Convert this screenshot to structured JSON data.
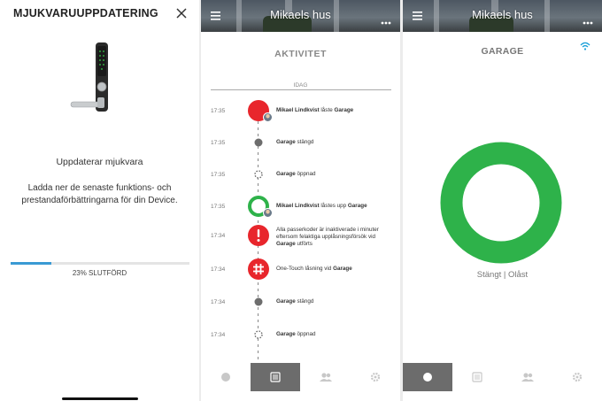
{
  "firmware": {
    "title": "MJUKVARUUPPDATERING",
    "updating_label": "Uppdaterar mjukvara",
    "description": "Ladda ner de senaste funktions- och prestandaförbättringarna för din Device.",
    "progress": 0.23,
    "progress_text": "23% SLUTFÖRD"
  },
  "activity": {
    "home_title": "Mikaels hus",
    "title": "AKTIVITET",
    "day_label": "IDAG",
    "events": [
      {
        "time": "17:35",
        "type": "user-locked",
        "color": "#e8262c",
        "actor": "Mikael Lindkvist",
        "action": " låste ",
        "target": "Garage"
      },
      {
        "time": "17:35",
        "type": "closed",
        "color": "#6d6d6d",
        "actor": "",
        "action": "",
        "target": "Garage",
        "suffix": " stängd"
      },
      {
        "time": "17:35",
        "type": "opened",
        "color": "#6d6d6d",
        "actor": "",
        "action": "",
        "target": "Garage",
        "suffix": " öppnad"
      },
      {
        "time": "17:35",
        "type": "user-unlocked",
        "color": "#2eb24a",
        "actor": "Mikael Lindkvist",
        "action": " låstes upp ",
        "target": "Garage"
      },
      {
        "time": "17:34",
        "type": "alert",
        "color": "#e8262c",
        "text": "Alla passerkoder är inaktiverade i minuter eftersom felaktiga upplåsningsförsök vid ",
        "target": "Garage",
        "suffix": " utförts"
      },
      {
        "time": "17:34",
        "type": "one-touch",
        "color": "#e8262c",
        "text": "One-Touch låsning vid ",
        "target": "Garage"
      },
      {
        "time": "17:34",
        "type": "closed",
        "color": "#6d6d6d",
        "actor": "",
        "action": "",
        "target": "Garage",
        "suffix": " stängd"
      },
      {
        "time": "17:34",
        "type": "opened",
        "color": "#6d6d6d",
        "actor": "",
        "action": "",
        "target": "Garage",
        "suffix": " öppnad"
      }
    ]
  },
  "device": {
    "home_title": "Mikaels hus",
    "title": "GARAGE",
    "status": "Stängt | Olåst",
    "ring_color": "#2eb24a"
  },
  "tabbar": {
    "tabs": [
      {
        "icon": "lock-circle-icon"
      },
      {
        "icon": "activity-list-icon"
      },
      {
        "icon": "users-icon"
      },
      {
        "icon": "settings-gear-icon"
      }
    ]
  }
}
